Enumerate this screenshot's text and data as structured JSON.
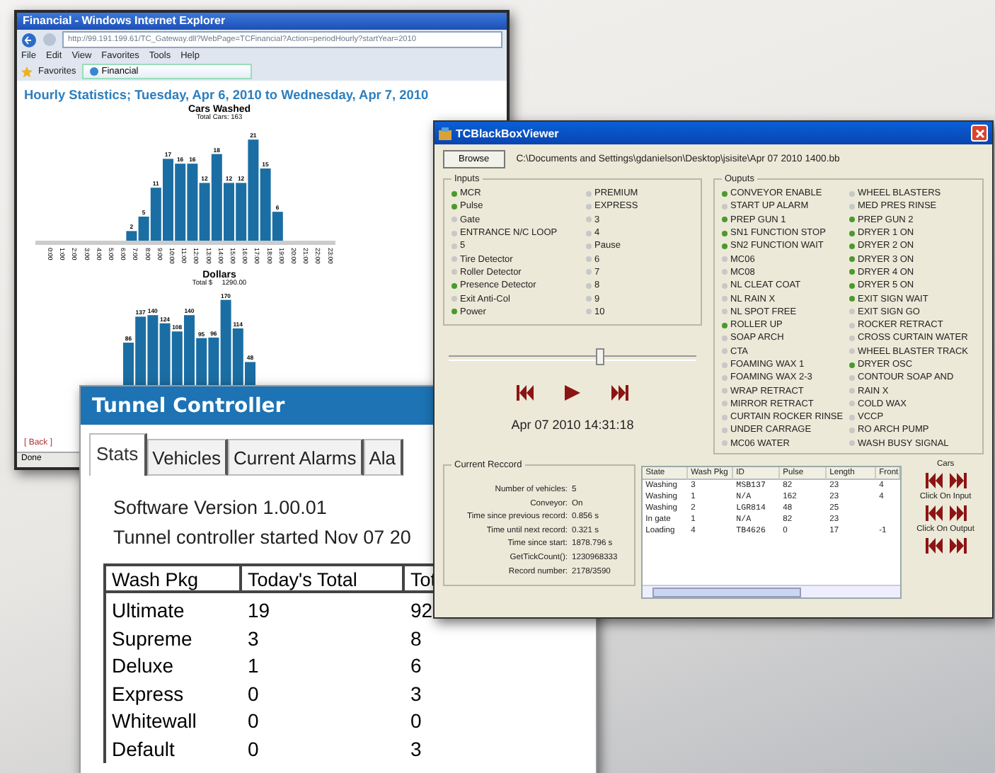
{
  "browser": {
    "title": "Financial - Windows Internet Explorer",
    "address": "http://99.191.199.61/TC_Gateway.dll?WebPage=TCFinancial?Action=periodHourly?startYear=2010",
    "menu": [
      "File",
      "Edit",
      "View",
      "Favorites",
      "Tools",
      "Help"
    ],
    "favorites": "Favorites",
    "tab": "Financial",
    "heading": "Hourly Statistics; Tuesday, Apr 6, 2010 to Wednesday, Apr 7, 2010",
    "cars_chart": {
      "subtitle": "Total Cars: 163",
      "chart_data": {
        "type": "bar",
        "title": "Cars Washed",
        "categories": [
          "0:00",
          "1:00",
          "2:00",
          "3:00",
          "4:00",
          "5:00",
          "6:00",
          "7:00",
          "8:00",
          "9:00",
          "10:00",
          "11:00",
          "12:00",
          "13:00",
          "14:00",
          "15:00",
          "16:00",
          "17:00",
          "18:00",
          "19:00",
          "20:00",
          "21:00",
          "22:00",
          "23:00"
        ],
        "values": [
          null,
          null,
          null,
          null,
          null,
          null,
          null,
          2,
          5,
          11,
          17,
          16,
          16,
          12,
          18,
          12,
          12,
          21,
          15,
          6,
          null,
          null,
          null,
          null
        ],
        "data_labels": true
      }
    },
    "dollars_chart": {
      "title": "Dollars",
      "subtitle": "Total $     1290.00",
      "bar_labels": [
        "86",
        "137",
        "140",
        "124",
        "108",
        "140",
        "95",
        "96",
        "170",
        "114",
        "48"
      ]
    },
    "back_link": "[ Back ]",
    "status": "Done"
  },
  "tunnel": {
    "title": "Tunnel Controller",
    "tabs": [
      {
        "label": "Stats",
        "selected": true
      },
      {
        "label": "Vehicles",
        "selected": false
      },
      {
        "label": "Current Alarms",
        "selected": false
      },
      {
        "label": "Ala",
        "selected": false
      }
    ],
    "lines": [
      "Software Version 1.00.01",
      "Tunnel controller started Nov 07 20"
    ],
    "columns": [
      "Wash Pkg",
      "Today's Total",
      "Tot"
    ],
    "rows": [
      [
        "Ultimate",
        "19",
        "92"
      ],
      [
        "Supreme",
        "3",
        "8"
      ],
      [
        "Deluxe",
        "1",
        "6"
      ],
      [
        "Express",
        "0",
        "3"
      ],
      [
        "Whitewall",
        "0",
        "0"
      ],
      [
        "Default",
        "0",
        "3"
      ]
    ]
  },
  "viewer": {
    "title": "TCBlackBoxViewer",
    "browse": "Browse",
    "path": "C:\\Documents and Settings\\gdanielson\\Desktop\\jsisite\\Apr 07 2010 1400.bb",
    "inputs": {
      "label": "Inputs",
      "columns": [
        [
          {
            "name": "MCR",
            "on": true
          },
          {
            "name": "Pulse",
            "on": true
          },
          {
            "name": "Gate",
            "on": false
          },
          {
            "name": "ENTRANCE N/C LOOP",
            "on": false
          },
          {
            "name": "5",
            "on": false
          },
          {
            "name": "Tire Detector",
            "on": false
          },
          {
            "name": "Roller Detector",
            "on": false
          },
          {
            "name": "Presence Detector",
            "on": true
          },
          {
            "name": "Exit Anti-Col",
            "on": false
          },
          {
            "name": "Power",
            "on": true
          }
        ],
        [
          {
            "name": "PREMIUM",
            "on": false
          },
          {
            "name": "EXPRESS",
            "on": false
          },
          {
            "name": "3",
            "on": false
          },
          {
            "name": "4",
            "on": false
          },
          {
            "name": "Pause",
            "on": false
          },
          {
            "name": "6",
            "on": false
          },
          {
            "name": "7",
            "on": false
          },
          {
            "name": "8",
            "on": false
          },
          {
            "name": "9",
            "on": false
          },
          {
            "name": "10",
            "on": false
          }
        ]
      ]
    },
    "outputs": {
      "label": "Ouputs",
      "columns": [
        [
          {
            "name": "CONVEYOR ENABLE",
            "on": true
          },
          {
            "name": "START UP ALARM",
            "on": false
          },
          {
            "name": "PREP GUN 1",
            "on": true
          },
          {
            "name": "SN1 FUNCTION STOP",
            "on": true
          },
          {
            "name": "SN2 FUNCTION WAIT",
            "on": true
          },
          {
            "name": "MC06",
            "on": false
          },
          {
            "name": "MC08",
            "on": false
          },
          {
            "name": "NL CLEAT COAT",
            "on": false
          },
          {
            "name": "NL RAIN X",
            "on": false
          },
          {
            "name": "NL SPOT FREE",
            "on": false
          },
          {
            "name": "ROLLER UP",
            "on": true
          },
          {
            "name": "SOAP ARCH",
            "on": false
          },
          {
            "name": "CTA",
            "on": false
          },
          {
            "name": "FOAMING WAX 1",
            "on": false
          },
          {
            "name": "FOAMING WAX 2-3",
            "on": false
          },
          {
            "name": "WRAP RETRACT",
            "on": false
          },
          {
            "name": "MIRROR RETRACT",
            "on": false
          },
          {
            "name": "CURTAIN ROCKER RINSE",
            "on": false
          },
          {
            "name": "UNDER CARRAGE",
            "on": false
          },
          {
            "name": "MC06 WATER",
            "on": false
          }
        ],
        [
          {
            "name": "WHEEL BLASTERS",
            "on": false
          },
          {
            "name": "MED PRES RINSE",
            "on": false
          },
          {
            "name": "PREP GUN 2",
            "on": true
          },
          {
            "name": "DRYER 1 ON",
            "on": true
          },
          {
            "name": "DRYER 2 ON",
            "on": true
          },
          {
            "name": "DRYER 3 ON",
            "on": true
          },
          {
            "name": "DRYER 4 ON",
            "on": true
          },
          {
            "name": "DRYER 5 ON",
            "on": true
          },
          {
            "name": "EXIT SIGN WAIT",
            "on": true
          },
          {
            "name": "EXIT SIGN GO",
            "on": false
          },
          {
            "name": "ROCKER RETRACT",
            "on": false
          },
          {
            "name": "CROSS CURTAIN WATER",
            "on": false
          },
          {
            "name": "WHEEL BLASTER TRACK",
            "on": false
          },
          {
            "name": "DRYER OSC",
            "on": true
          },
          {
            "name": "CONTOUR SOAP AND",
            "on": false
          },
          {
            "name": "RAIN X",
            "on": false
          },
          {
            "name": "COLD WAX",
            "on": false
          },
          {
            "name": "VCCP",
            "on": false
          },
          {
            "name": "RO ARCH PUMP",
            "on": false
          },
          {
            "name": "WASH BUSY SIGNAL",
            "on": false
          }
        ]
      ]
    },
    "slider": {
      "level": 0.61
    },
    "timestamp": "Apr 07 2010 14:31:18",
    "record": {
      "label": "Current Reccord",
      "fields": [
        {
          "label": "Number of vehicles:",
          "value": "5"
        },
        {
          "label": "Conveyor:",
          "value": "On"
        },
        {
          "label": "Time since previous record:",
          "value": "0.856 s"
        },
        {
          "label": "Time until next record:",
          "value": "0.321 s"
        },
        {
          "label": "Time since start:",
          "value": "1878.796 s"
        },
        {
          "label": "GetTickCount():",
          "value": "1230968333"
        },
        {
          "label": "Record number:",
          "value": "2178/3590"
        }
      ]
    },
    "table": {
      "columns": [
        "State",
        "Wash Pkg",
        "ID",
        "Pulse",
        "Length",
        "Front"
      ],
      "rows": [
        [
          "Washing",
          "3",
          "MSB137",
          "82",
          "23",
          "4"
        ],
        [
          "Washing",
          "1",
          "N/A",
          "162",
          "23",
          "4"
        ],
        [
          "Washing",
          "2",
          "LGR814",
          "48",
          "25",
          null
        ],
        [
          "In gate",
          "1",
          "N/A",
          "82",
          "23",
          null
        ],
        [
          "Loading",
          "4",
          "TB4626",
          "0",
          "17",
          "-1"
        ]
      ]
    },
    "nav_labels": [
      "Cars",
      "Click On Input",
      "Click On Output"
    ]
  }
}
